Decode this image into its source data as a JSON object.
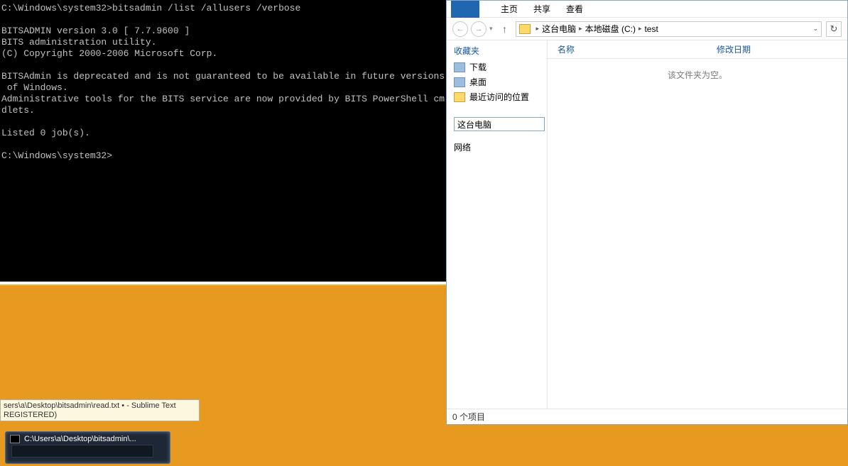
{
  "cmd": {
    "prompt_path": "C:\\Windows\\system32>",
    "command": "bitsadmin /list /allusers /verbose",
    "output_lines": [
      "",
      "BITSADMIN version 3.0 [ 7.7.9600 ]",
      "BITS administration utility.",
      "(C) Copyright 2000-2006 Microsoft Corp.",
      "",
      "BITSAdmin is deprecated and is not guaranteed to be available in future versions",
      " of Windows.",
      "Administrative tools for the BITS service are now provided by BITS PowerShell cm",
      "dlets.",
      "",
      "Listed 0 job(s).",
      ""
    ],
    "prompt_wait": "C:\\Windows\\system32>"
  },
  "explorer": {
    "tabs": {
      "home": "主页",
      "share": "共享",
      "view": "查看"
    },
    "breadcrumbs": {
      "pc": "这台电脑",
      "drive": "本地磁盘 (C:)",
      "folder": "test"
    },
    "sidebar": {
      "favorites_header": "收藏夹",
      "favorites": [
        {
          "label": "下载"
        },
        {
          "label": "桌面"
        },
        {
          "label": "最近访问的位置"
        }
      ],
      "this_pc_value": "这台电脑",
      "network_header": "网络"
    },
    "columns": {
      "name": "名称",
      "modified": "修改日期"
    },
    "empty_text": "该文件夹为空。",
    "status": "0 个项目"
  },
  "tooltip": {
    "line1": "sers\\a\\Desktop\\bitsadmin\\read.txt • - Sublime Text",
    "line2": "REGISTERED)"
  },
  "taskbar": {
    "title": "C:\\Users\\a\\Desktop\\bitsadmin\\..."
  }
}
